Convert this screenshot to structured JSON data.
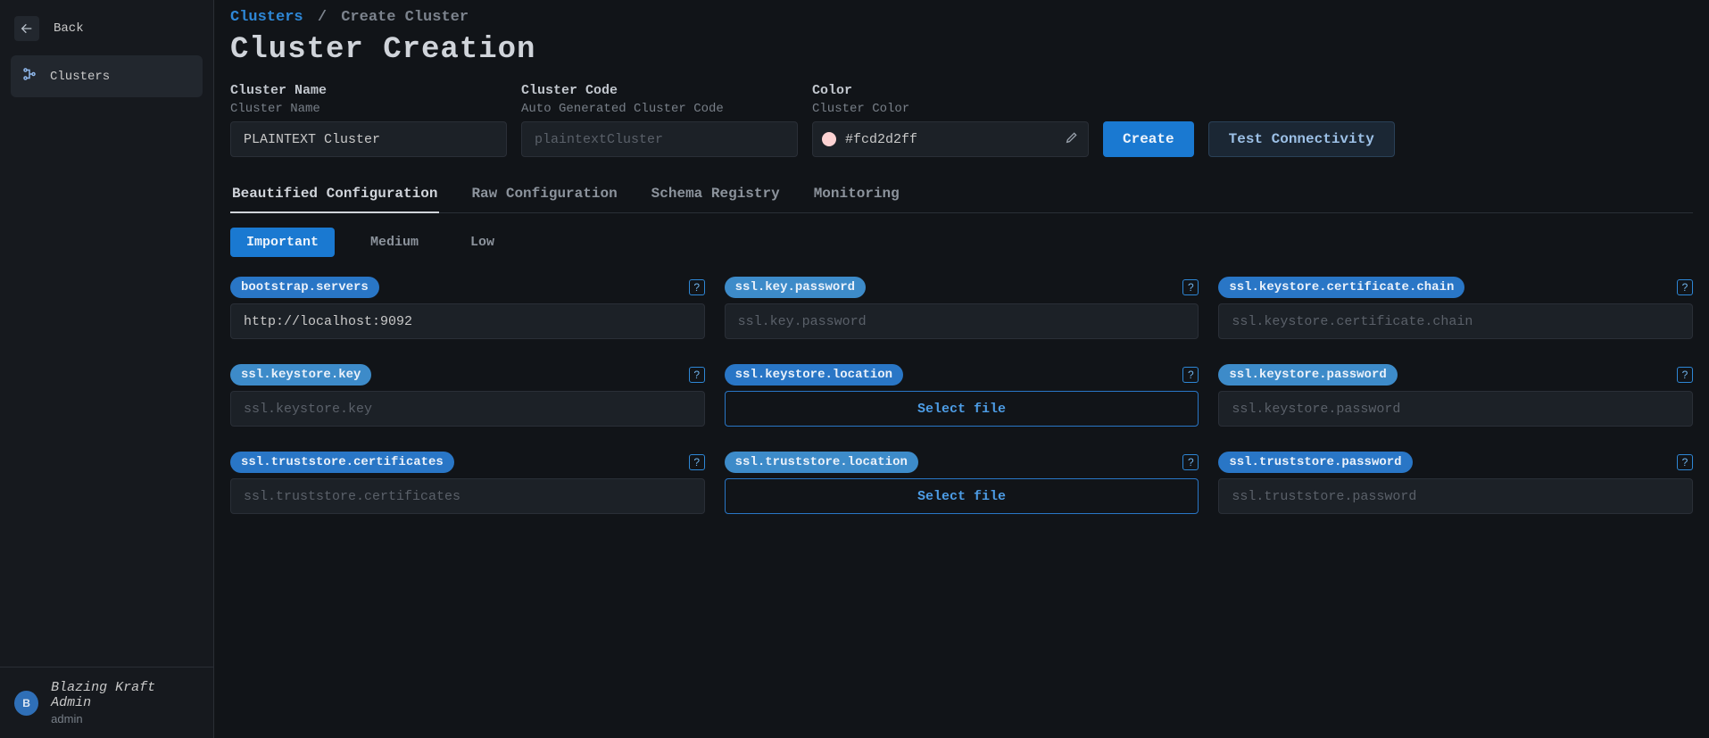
{
  "sidebar": {
    "back_label": "Back",
    "items": [
      {
        "label": "Clusters"
      }
    ],
    "user": {
      "avatar_initial": "B",
      "name": "Blazing Kraft Admin",
      "role": "admin"
    }
  },
  "breadcrumb": {
    "root": "Clusters",
    "current": "Create Cluster"
  },
  "page_title": "Cluster Creation",
  "form": {
    "name": {
      "label": "Cluster Name",
      "sublabel": "Cluster Name",
      "value": "PLAINTEXT Cluster"
    },
    "code": {
      "label": "Cluster Code",
      "sublabel": "Auto Generated Cluster Code",
      "placeholder": "plaintextCluster"
    },
    "color": {
      "label": "Color",
      "sublabel": "Cluster Color",
      "value": "#fcd2d2ff",
      "swatch": "#fcd2d2"
    },
    "create_label": "Create",
    "test_label": "Test Connectivity"
  },
  "tabs": [
    {
      "label": "Beautified Configuration",
      "active": true
    },
    {
      "label": "Raw Configuration",
      "active": false
    },
    {
      "label": "Schema Registry",
      "active": false
    },
    {
      "label": "Monitoring",
      "active": false
    }
  ],
  "levels": [
    {
      "label": "Important",
      "active": true
    },
    {
      "label": "Medium",
      "active": false
    },
    {
      "label": "Low",
      "active": false
    }
  ],
  "config": {
    "select_file_label": "Select file",
    "fields": [
      {
        "key": "bootstrap.servers",
        "value": "http://localhost:9092",
        "placeholder": "",
        "type": "text"
      },
      {
        "key": "ssl.key.password",
        "value": "",
        "placeholder": "ssl.key.password",
        "type": "text"
      },
      {
        "key": "ssl.keystore.certificate.chain",
        "value": "",
        "placeholder": "ssl.keystore.certificate.chain",
        "type": "text"
      },
      {
        "key": "ssl.keystore.key",
        "value": "",
        "placeholder": "ssl.keystore.key",
        "type": "text"
      },
      {
        "key": "ssl.keystore.location",
        "value": "",
        "placeholder": "",
        "type": "file"
      },
      {
        "key": "ssl.keystore.password",
        "value": "",
        "placeholder": "ssl.keystore.password",
        "type": "text"
      },
      {
        "key": "ssl.truststore.certificates",
        "value": "",
        "placeholder": "ssl.truststore.certificates",
        "type": "text"
      },
      {
        "key": "ssl.truststore.location",
        "value": "",
        "placeholder": "",
        "type": "file"
      },
      {
        "key": "ssl.truststore.password",
        "value": "",
        "placeholder": "ssl.truststore.password",
        "type": "text"
      }
    ]
  }
}
